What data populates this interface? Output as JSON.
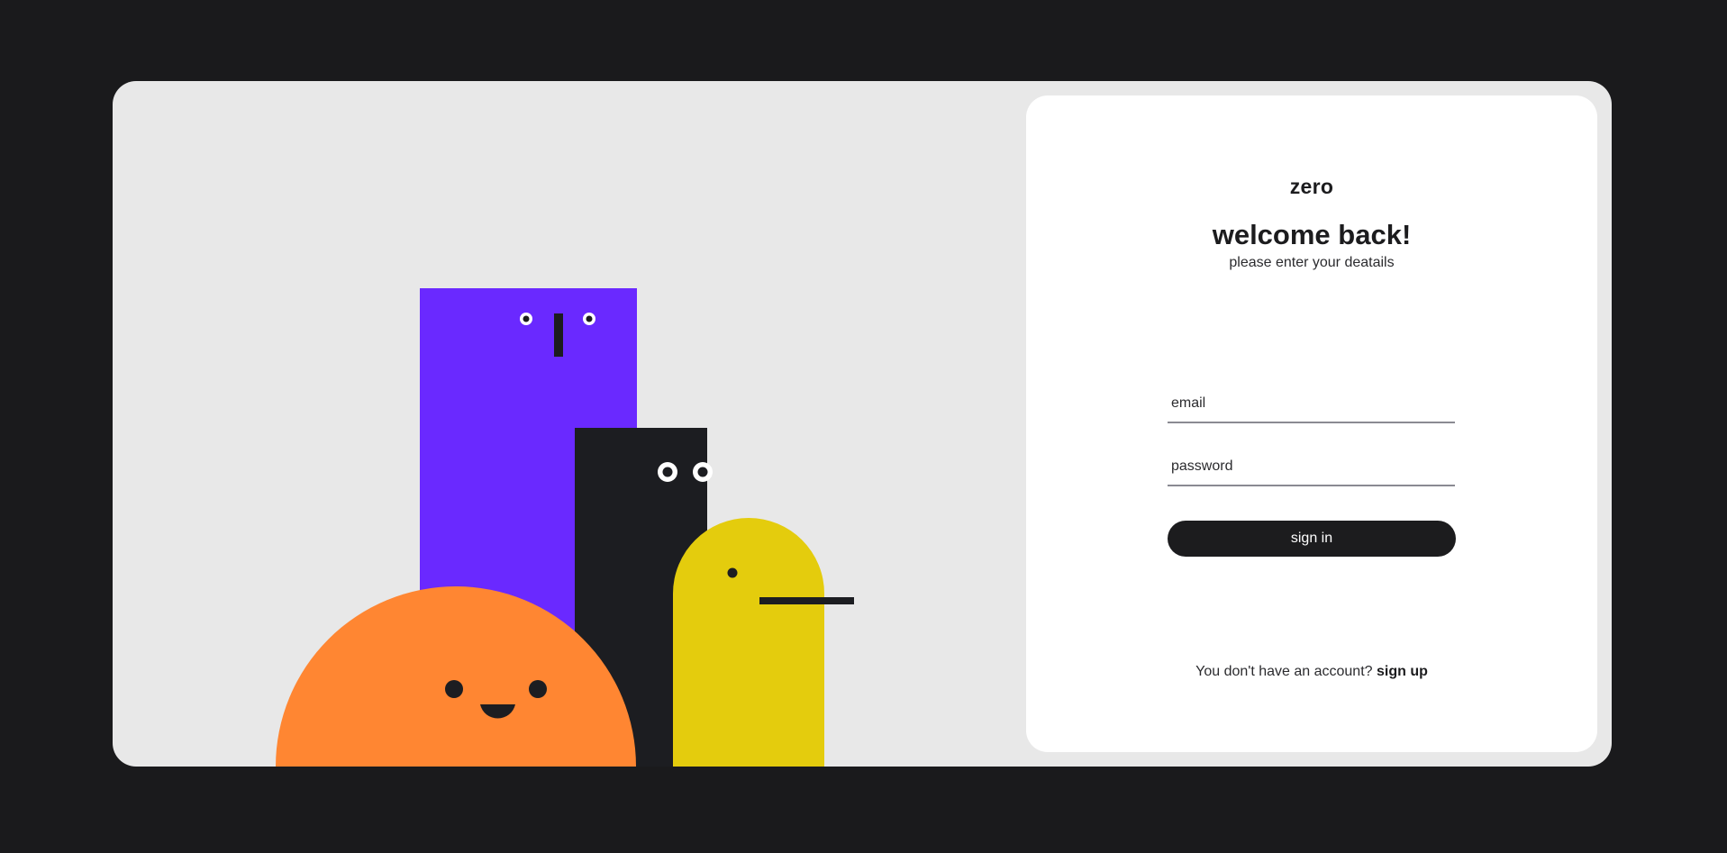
{
  "brand": {
    "logo_text": "zero"
  },
  "login": {
    "title": "welcome back!",
    "subtitle": "please enter your deatails",
    "email_placeholder": "email",
    "password_placeholder": "password",
    "signin_label": "sign in",
    "no_account_text": "You don't have an account? ",
    "signup_label": "sign up"
  },
  "colors": {
    "page_background": "#1a1a1c",
    "card_background": "#e8e8e8",
    "panel_background": "#ffffff",
    "purple_character": "#6a29ff",
    "black_character": "#1c1d21",
    "orange_character": "#ff8632",
    "yellow_character": "#e4cc0d",
    "button": "#1c1c1e"
  }
}
